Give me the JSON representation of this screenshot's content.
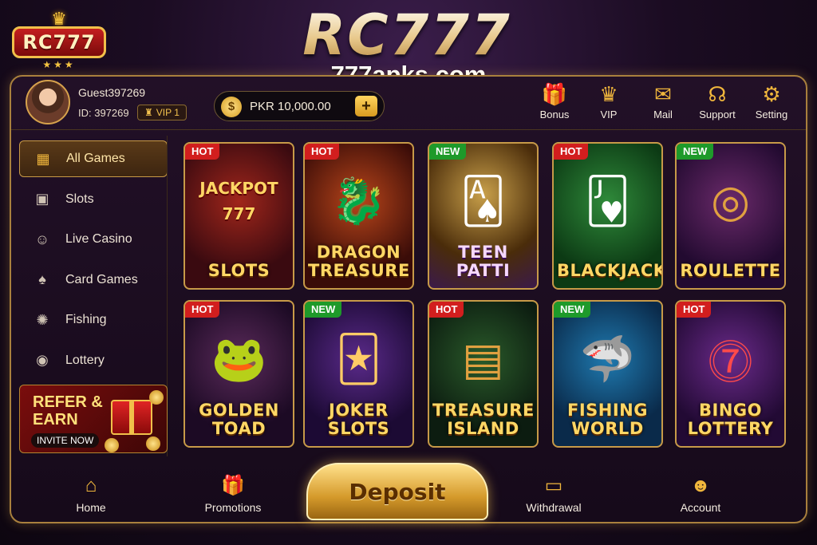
{
  "brand": {
    "logo_text": "RC777",
    "title": "RC777",
    "domain": "777apks.com"
  },
  "user": {
    "name": "Guest397269",
    "id_label": "ID: 397269",
    "vip_label": "VIP 1"
  },
  "wallet": {
    "balance": "PKR 10,000.00",
    "add_symbol": "+"
  },
  "top_nav": [
    {
      "label": "Bonus",
      "icon": "gift-icon"
    },
    {
      "label": "VIP",
      "icon": "crown-icon"
    },
    {
      "label": "Mail",
      "icon": "mail-icon"
    },
    {
      "label": "Support",
      "icon": "headset-icon"
    },
    {
      "label": "Setting",
      "icon": "gear-icon"
    }
  ],
  "sidebar": {
    "items": [
      {
        "label": "All Games",
        "icon": "grid-icon",
        "active": true
      },
      {
        "label": "Slots",
        "icon": "slot-machine-icon"
      },
      {
        "label": "Live Casino",
        "icon": "dealer-icon"
      },
      {
        "label": "Card Games",
        "icon": "cards-icon"
      },
      {
        "label": "Fishing",
        "icon": "fish-icon"
      },
      {
        "label": "Lottery",
        "icon": "lottery-ball-icon"
      }
    ],
    "promo": {
      "title_line1": "REFER &",
      "title_line2": "EARN",
      "cta": "INVITE NOW"
    }
  },
  "games": [
    {
      "tag": "HOT",
      "name_line1": "SLOTS",
      "art_text": "JACKPOT 777"
    },
    {
      "tag": "HOT",
      "name_line1": "DRAGON",
      "name_line2": "TREASURE"
    },
    {
      "tag": "NEW",
      "name_line1": "TEEN PATTI"
    },
    {
      "tag": "HOT",
      "name_line1": "BLACKJACK"
    },
    {
      "tag": "NEW",
      "name_line1": "ROULETTE"
    },
    {
      "tag": "HOT",
      "name_line1": "GOLDEN",
      "name_line2": "TOAD"
    },
    {
      "tag": "NEW",
      "name_line1": "JOKER",
      "name_line2": "SLOTS"
    },
    {
      "tag": "HOT",
      "name_line1": "TREASURE",
      "name_line2": "ISLAND"
    },
    {
      "tag": "NEW",
      "name_line1": "FISHING",
      "name_line2": "WORLD"
    },
    {
      "tag": "HOT",
      "name_line1": "BINGO",
      "name_line2": "LOTTERY"
    }
  ],
  "bottom_nav": {
    "home": "Home",
    "promotions": "Promotions",
    "deposit": "Deposit",
    "withdrawal": "Withdrawal",
    "account": "Account"
  },
  "colors": {
    "accent_gold": "#f0b63c",
    "hot_tag": "#d21e1e",
    "new_tag": "#1e9a2a",
    "panel_border": "#a9803d"
  }
}
